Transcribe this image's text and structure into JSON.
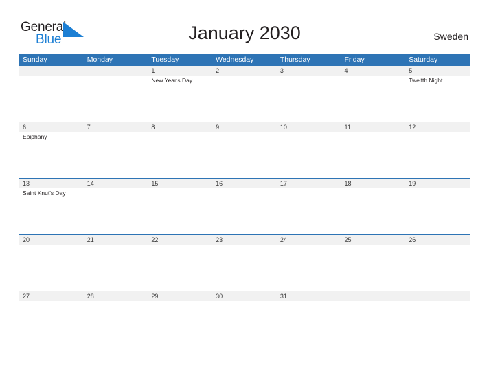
{
  "brand": {
    "name_part1": "General",
    "name_part2": "Blue",
    "triangle_color": "#1c7fd4",
    "text_color": "#231f20"
  },
  "header": {
    "title": "January 2030",
    "country": "Sweden"
  },
  "theme": {
    "header_blue": "#2e74b5",
    "band_gray": "#f1f1f1",
    "body_white": "#ffffff",
    "text_dark": "#231f20"
  },
  "calendar": {
    "weekdays": [
      "Sunday",
      "Monday",
      "Tuesday",
      "Wednesday",
      "Thursday",
      "Friday",
      "Saturday"
    ],
    "weeks": [
      {
        "days": [
          {
            "num": "",
            "event": ""
          },
          {
            "num": "",
            "event": ""
          },
          {
            "num": "1",
            "event": "New Year's Day"
          },
          {
            "num": "2",
            "event": ""
          },
          {
            "num": "3",
            "event": ""
          },
          {
            "num": "4",
            "event": ""
          },
          {
            "num": "5",
            "event": "Twelfth Night"
          }
        ]
      },
      {
        "days": [
          {
            "num": "6",
            "event": "Epiphany"
          },
          {
            "num": "7",
            "event": ""
          },
          {
            "num": "8",
            "event": ""
          },
          {
            "num": "9",
            "event": ""
          },
          {
            "num": "10",
            "event": ""
          },
          {
            "num": "11",
            "event": ""
          },
          {
            "num": "12",
            "event": ""
          }
        ]
      },
      {
        "days": [
          {
            "num": "13",
            "event": "Saint Knut's Day"
          },
          {
            "num": "14",
            "event": ""
          },
          {
            "num": "15",
            "event": ""
          },
          {
            "num": "16",
            "event": ""
          },
          {
            "num": "17",
            "event": ""
          },
          {
            "num": "18",
            "event": ""
          },
          {
            "num": "19",
            "event": ""
          }
        ]
      },
      {
        "days": [
          {
            "num": "20",
            "event": ""
          },
          {
            "num": "21",
            "event": ""
          },
          {
            "num": "22",
            "event": ""
          },
          {
            "num": "23",
            "event": ""
          },
          {
            "num": "24",
            "event": ""
          },
          {
            "num": "25",
            "event": ""
          },
          {
            "num": "26",
            "event": ""
          }
        ]
      },
      {
        "days": [
          {
            "num": "27",
            "event": ""
          },
          {
            "num": "28",
            "event": ""
          },
          {
            "num": "29",
            "event": ""
          },
          {
            "num": "30",
            "event": ""
          },
          {
            "num": "31",
            "event": ""
          },
          {
            "num": "",
            "event": ""
          },
          {
            "num": "",
            "event": ""
          }
        ]
      }
    ]
  }
}
